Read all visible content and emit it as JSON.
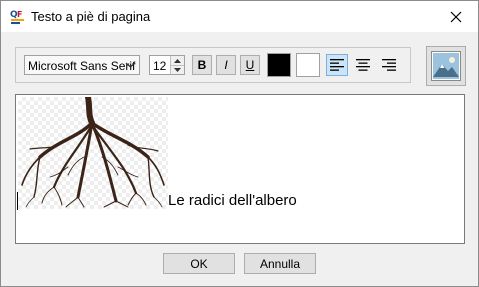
{
  "window": {
    "title": "Testo a piè di pagina"
  },
  "toolbar": {
    "font_name": "Microsoft Sans Serif",
    "font_size": "12",
    "bold_label": "B",
    "italic_label": "I",
    "underline_label": "U",
    "foreground_color": "#000000",
    "background_color": "#ffffff",
    "alignment_selected": "left"
  },
  "editor": {
    "text": "Le radici dell'albero"
  },
  "buttons": {
    "ok_label": "OK",
    "cancel_label": "Annulla"
  },
  "icons": {
    "app": "app-icon",
    "close": "close-icon",
    "image": "insert-image-icon"
  },
  "colors": {
    "selection_accent": "#cce4f7",
    "root_color": "#3b2318"
  }
}
